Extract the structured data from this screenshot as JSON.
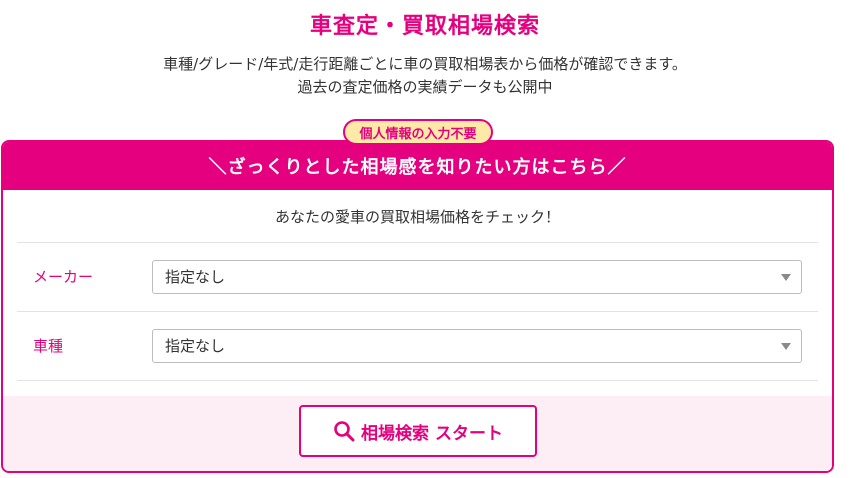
{
  "header": {
    "title": "車査定・買取相場検索",
    "description_line1": "車種/グレード/年式/走行距離ごとに車の買取相場表から価格が確認できます。",
    "description_line2": "過去の査定価格の実績データも公開中"
  },
  "card": {
    "badge": "個人情報の入力不要",
    "header_title": "＼ざっくりとした相場感を知りたい方はこちら／",
    "lead": "あなたの愛車の買取相場価格をチェック！",
    "fields": [
      {
        "label": "メーカー",
        "selected": "指定なし"
      },
      {
        "label": "車種",
        "selected": "指定なし"
      }
    ],
    "search_button": {
      "label": "相場検索 スタート",
      "icon": "search-icon"
    }
  },
  "colors": {
    "accent": "#e4007f",
    "badge_bg": "#ffe9a6",
    "footer_bg": "#fdeef5"
  }
}
